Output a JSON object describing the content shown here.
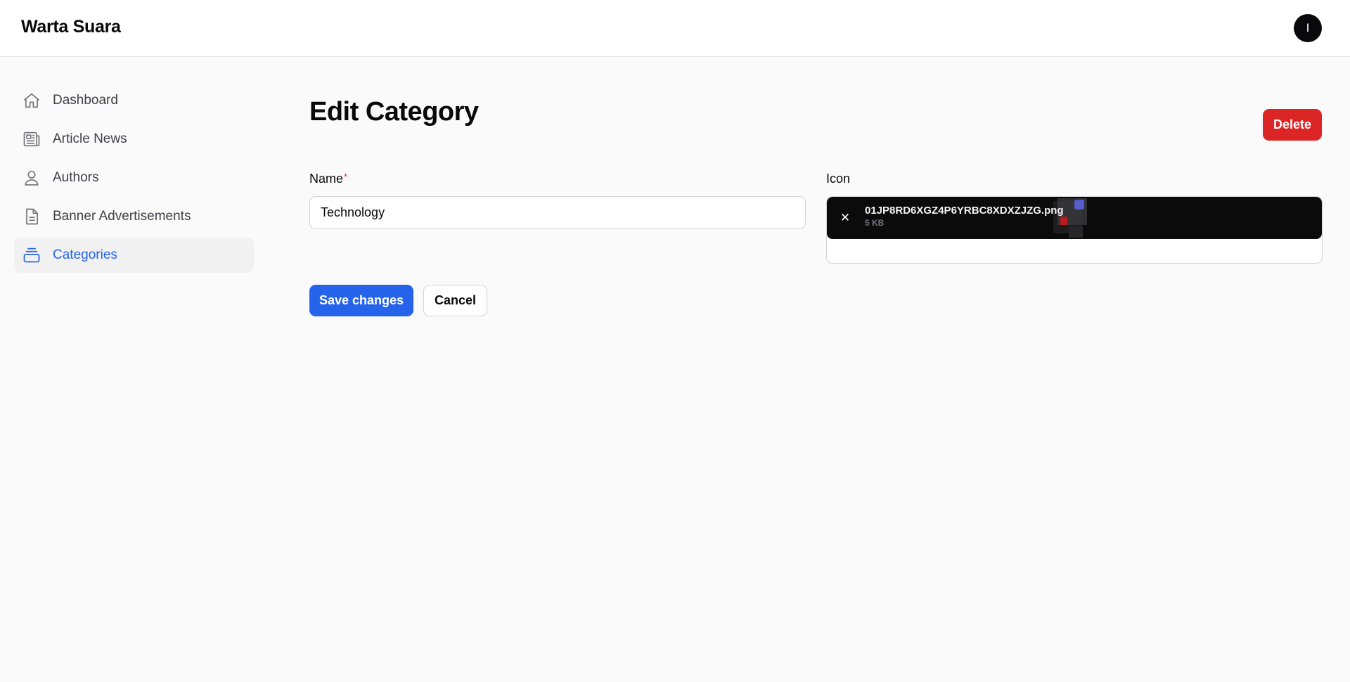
{
  "header": {
    "brand": "Warta Suara",
    "avatar_initial": "I"
  },
  "sidebar": {
    "items": [
      {
        "label": "Dashboard",
        "icon": "home-icon",
        "active": false
      },
      {
        "label": "Article News",
        "icon": "newspaper-icon",
        "active": false
      },
      {
        "label": "Authors",
        "icon": "user-icon",
        "active": false
      },
      {
        "label": "Banner Advertisements",
        "icon": "document-icon",
        "active": false
      },
      {
        "label": "Categories",
        "icon": "stack-icon",
        "active": true
      }
    ]
  },
  "page": {
    "title": "Edit Category",
    "delete_label": "Delete"
  },
  "form": {
    "name_label": "Name",
    "required_mark": "*",
    "name_value": "Technology",
    "icon_label": "Icon",
    "file": {
      "name": "01JP8RD6XGZ4P6YRBC8XDXZJZG.png",
      "size": "5 KB",
      "remove_glyph": "✕"
    },
    "save_label": "Save changes",
    "cancel_label": "Cancel"
  },
  "colors": {
    "primary": "#2563eb",
    "danger": "#dc2626",
    "background": "#fafafa",
    "upload_panel": "#0b0b0c"
  }
}
